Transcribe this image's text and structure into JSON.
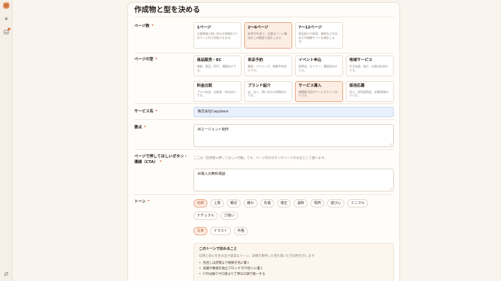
{
  "colors": {
    "accent": "#e07a45",
    "selected_bg": "#fdeee4",
    "selected_border": "#e8a482",
    "input_bg": "#e8f0fd"
  },
  "sidebar": {
    "icons": [
      "app-logo-icon",
      "sparkle-plus-icon",
      "inbox-icon",
      "swap-arrows-icon"
    ],
    "inbox_has_badge": true
  },
  "form": {
    "title": "作成物と型を決める",
    "page_count": {
      "label": "ページ数",
      "required_mark": "*",
      "options": [
        {
          "title": "1ページ",
          "desc": "主要情報と問い合わせ導線を1つのページ内で完結させます。",
          "selected": false
        },
        {
          "title": "2〜6ページ",
          "desc": "参考LPを見て、必要なページ構成をこの範囲で設計します。",
          "selected": true
        },
        {
          "title": "7〜12ページ",
          "desc": "商品紹介や採用、事例などを含めた中規模サイトを想定します。",
          "selected": false
        }
      ]
    },
    "page_type": {
      "label": "ページの型",
      "required_mark": "*",
      "options": [
        {
          "title": "商品販売・EC",
          "desc": "物販、食品、D2C、通販向けです。",
          "selected": false
        },
        {
          "title": "来店予約",
          "desc": "美容、クリニック、体験予約向けです。",
          "selected": false
        },
        {
          "title": "イベント申込",
          "desc": "説明会、セミナー、講演会向けです。",
          "selected": false
        },
        {
          "title": "地域サービス",
          "desc": "生活支援、施工、出張対応向けです。",
          "selected": false
        },
        {
          "title": "料金比較",
          "desc": "プラン料金、比較表、申込向けです。",
          "selected": false
        },
        {
          "title": "ブランド紹介",
          "desc": "店、法人、問い合わせ導線向けです。",
          "selected": false
        },
        {
          "title": "サービス導入",
          "desc": "課題解決型のサービスサイト向けです。",
          "selected": true
        },
        {
          "title": "採用応募",
          "desc": "求人、採用説明会、応募導線向けです。",
          "selected": false
        }
      ]
    },
    "service_name": {
      "label": "サービス名",
      "required_mark": "*",
      "value": "株式会社Capybara"
    },
    "key_points": {
      "label": "要点",
      "required_mark": "*",
      "value": "AIエージェント制作"
    },
    "cta": {
      "label": "ページで押してほしいボタン・導線（CTA）",
      "required_mark": "*",
      "help": "ここは「訪問者に押してほしい行動」です。ページ内のボタンやリンクの文言として使います。",
      "value": "AI導入の無料相談"
    },
    "tone": {
      "label": "トーン",
      "required_mark": "*",
      "chips": [
        {
          "label": "信頼",
          "selected": true
        },
        {
          "label": "上質",
          "selected": false
        },
        {
          "label": "親近",
          "selected": false
        },
        {
          "label": "静か",
          "selected": false
        },
        {
          "label": "先進",
          "selected": false
        },
        {
          "label": "端正",
          "selected": false
        },
        {
          "label": "温和",
          "selected": false
        },
        {
          "label": "情熱",
          "selected": false
        },
        {
          "label": "遊び心",
          "selected": false
        },
        {
          "label": "ミニマル",
          "selected": false
        },
        {
          "label": "ナチュラル",
          "selected": false
        },
        {
          "label": "力強い",
          "selected": false
        }
      ],
      "media_chips": [
        {
          "label": "写真",
          "selected": true
        },
        {
          "label": "イラスト",
          "selected": false
        },
        {
          "label": "手描",
          "selected": false
        }
      ]
    },
    "tone_info": {
      "title": "このトーンで伝わること",
      "desc": "信頼と安心を生み出す誠実なトーン。実績を重視した落ち着いた方向性を示します",
      "bullets": [
        "見出しは誇張より根拠を先に置く",
        "実績や数値を独立ブロックでFV近くに置く",
        "CTAは煽りや口語より丁寧な口調で統一する"
      ]
    }
  }
}
